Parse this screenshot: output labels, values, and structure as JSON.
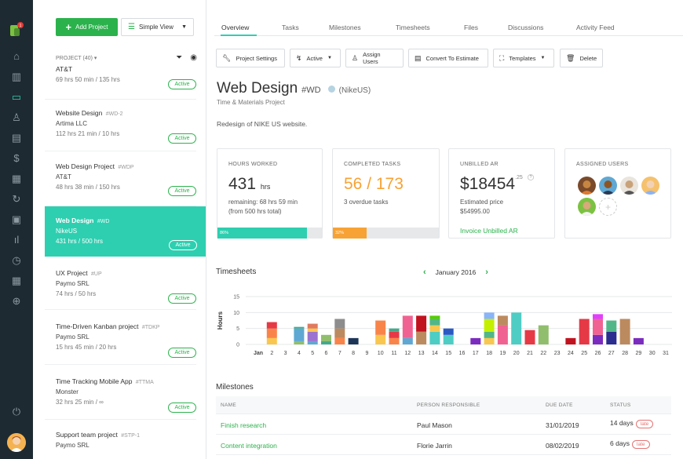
{
  "app": {
    "notification_count": "1"
  },
  "sidebar_list": {
    "add_button": "Add Project",
    "view_button": "Simple View",
    "header": "PROJECT (40) ▾",
    "active_label": "Active",
    "projects": [
      {
        "name": "AT&T",
        "code": "",
        "client": "",
        "hours": "69 hrs 50 min / 135 hrs"
      },
      {
        "name": "Website Design",
        "code": "#WD-2",
        "client": "Artima LLC",
        "hours": "112 hrs 21 min / 10 hrs"
      },
      {
        "name": "Web Design Project",
        "code": "#WDP",
        "client": "AT&T",
        "hours": "48 hrs 38 min / 150 hrs"
      },
      {
        "name": "Web Design",
        "code": "#WD",
        "client": "NikeUS",
        "hours": "431 hrs / 500 hrs"
      },
      {
        "name": "UX Project",
        "code": "#UP",
        "client": "Paymo SRL",
        "hours": "74 hrs / 50 hrs"
      },
      {
        "name": "Time-Driven Kanban project",
        "code": "#TDKP",
        "client": "Paymo SRL",
        "hours": "15 hrs 45 min / 20 hrs"
      },
      {
        "name": "Time Tracking Mobile App",
        "code": "#TTMA",
        "client": "Monster",
        "hours": "32 hrs 25 min / ∞"
      },
      {
        "name": "Support team project",
        "code": "#STP-1",
        "client": "Paymo SRL",
        "hours": ""
      }
    ]
  },
  "tabs": [
    "Overview",
    "Tasks",
    "Milestones",
    "Timesheets",
    "Files",
    "Discussions",
    "Activity Feed"
  ],
  "toolbar": {
    "settings": "Project Settings",
    "status": "Active",
    "assign": "Assign Users",
    "convert": "Convert To Estimate",
    "templates": "Templates",
    "delete": "Delete"
  },
  "project": {
    "title": "Web Design",
    "code": "#WD",
    "client": "(NikeUS)",
    "type": "Time & Materials Project",
    "description": "Redesign of NIKE US website."
  },
  "cards": {
    "hours": {
      "label": "HOURS WORKED",
      "value": "431",
      "unit": "hrs",
      "line1": "remaining: 68 hrs 59 min",
      "line2": "(from 500 hrs total)",
      "progress_label": "86%",
      "progress": 0.86
    },
    "tasks": {
      "label": "COMPLETED TASKS",
      "value": "56 / 173",
      "line1": "3 overdue tasks",
      "progress_label": "32%",
      "progress": 0.32
    },
    "unbilled": {
      "label": "UNBILLED AR",
      "value": "$18454",
      "cents": ".25",
      "help": "?",
      "line1": "Estimated price",
      "line2": "$54995.00",
      "link": "Invoice Unbilled AR"
    },
    "users": {
      "label": "ASSIGNED USERS",
      "add": "+"
    }
  },
  "timesheets": {
    "title": "Timesheets",
    "month": "January 2016",
    "prev": "‹",
    "next": "›"
  },
  "chart_data": {
    "type": "bar",
    "ylabel": "Hours",
    "ylim": [
      0,
      15
    ],
    "yticks": [
      0,
      5,
      10,
      15
    ],
    "x_first_label": "Jan",
    "categories": [
      "1",
      "2",
      "3",
      "4",
      "5",
      "6",
      "7",
      "8",
      "9",
      "10",
      "11",
      "12",
      "13",
      "14",
      "15",
      "16",
      "17",
      "18",
      "19",
      "20",
      "21",
      "22",
      "23",
      "24",
      "25",
      "26",
      "27",
      "28",
      "29",
      "30",
      "31"
    ],
    "stacks": [
      [],
      [
        [
          2,
          "#f9c74f"
        ],
        [
          3,
          "#f9844a"
        ],
        [
          2,
          "#e63946"
        ]
      ],
      [],
      [
        [
          1,
          "#90be6d"
        ],
        [
          4,
          "#5fa8d3"
        ],
        [
          0.5,
          "#43aa8b"
        ]
      ],
      [
        [
          1,
          "#5fa8d3"
        ],
        [
          3,
          "#9b72cf"
        ],
        [
          1,
          "#f9c74f"
        ],
        [
          1.5,
          "#e07a5f"
        ]
      ],
      [
        [
          1,
          "#43aa8b"
        ],
        [
          2,
          "#90be6d"
        ]
      ],
      [
        [
          2,
          "#f9844a"
        ],
        [
          3,
          "#bc8a5f"
        ],
        [
          3,
          "#8d8d8d"
        ]
      ],
      [
        [
          2,
          "#1d3557"
        ]
      ],
      [],
      [
        [
          3,
          "#f9c74f"
        ],
        [
          4.5,
          "#f9844a"
        ]
      ],
      [
        [
          2,
          "#f9844a"
        ],
        [
          2,
          "#e63946"
        ],
        [
          1,
          "#43aa8b"
        ]
      ],
      [
        [
          2,
          "#5fa8d3"
        ],
        [
          7,
          "#f06292"
        ]
      ],
      [
        [
          4,
          "#bc8a5f"
        ],
        [
          5,
          "#c1121f"
        ]
      ],
      [
        [
          4,
          "#4ecdc4"
        ],
        [
          2,
          "#f9c74f"
        ],
        [
          2,
          "#52b788"
        ],
        [
          1,
          "#57cc04"
        ]
      ],
      [
        [
          3,
          "#4ecdc4"
        ],
        [
          2,
          "#2b59c3"
        ]
      ],
      [],
      [
        [
          2,
          "#7b2cbf"
        ]
      ],
      [
        [
          2,
          "#f9c74f"
        ],
        [
          2,
          "#52b788"
        ],
        [
          4,
          "#c4f000"
        ],
        [
          2,
          "#8ab4f8"
        ]
      ],
      [
        [
          6,
          "#f06292"
        ],
        [
          3,
          "#bc8a5f"
        ]
      ],
      [
        [
          10,
          "#4ecdc4"
        ]
      ],
      [
        [
          4.5,
          "#e63946"
        ]
      ],
      [
        [
          6,
          "#90be6d"
        ]
      ],
      [],
      [
        [
          2,
          "#c1121f"
        ]
      ],
      [
        [
          8,
          "#e63946"
        ]
      ],
      [
        [
          3,
          "#7b2cbf"
        ],
        [
          5,
          "#f06292"
        ],
        [
          1.5,
          "#e040fb"
        ]
      ],
      [
        [
          4,
          "#2b2d8f"
        ],
        [
          3.5,
          "#52b788"
        ]
      ],
      [
        [
          8,
          "#bc8a5f"
        ]
      ],
      [
        [
          2,
          "#7b2cbf"
        ]
      ],
      [],
      []
    ]
  },
  "milestones": {
    "title": "Milestones",
    "columns": [
      "NAME",
      "PERSON RESPONSIBLE",
      "DUE DATE",
      "STATUS"
    ],
    "late_label": "late",
    "rows": [
      {
        "name": "Finish research",
        "person": "Paul Mason",
        "due": "31/01/2019",
        "status": "14 days"
      },
      {
        "name": "Content integration",
        "person": "Florie Jarrin",
        "due": "08/02/2019",
        "status": "6 days"
      }
    ]
  }
}
